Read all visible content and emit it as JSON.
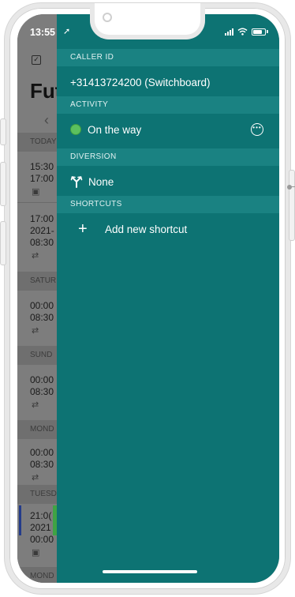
{
  "status_bar": {
    "time": "13:55"
  },
  "background_app": {
    "title": "Fut",
    "sections": [
      {
        "label": "TODAY",
        "rows": [
          [
            "15:30",
            "17:00"
          ]
        ]
      },
      {
        "label": "",
        "rows": [
          [
            "17:00",
            "2021-",
            "08:30"
          ]
        ]
      },
      {
        "label": "SATUR",
        "rows": [
          [
            "00:00",
            "08:30"
          ]
        ]
      },
      {
        "label": "SUND",
        "rows": [
          [
            "00:00",
            "08:30"
          ]
        ]
      },
      {
        "label": "MOND",
        "rows": [
          [
            "00:00",
            "08:30"
          ]
        ]
      },
      {
        "label": "TUESD",
        "rows": [
          [
            "21:0(",
            "2021",
            "00:00"
          ]
        ]
      },
      {
        "label": "MOND",
        "rows": []
      }
    ]
  },
  "drawer": {
    "caller_id": {
      "header": "CALLER ID",
      "value": "+31413724200 (Switchboard)"
    },
    "activity": {
      "header": "ACTIVITY",
      "value": "On the way",
      "status_color": "#5cc05e"
    },
    "diversion": {
      "header": "DIVERSION",
      "value": "None"
    },
    "shortcuts": {
      "header": "SHORTCUTS",
      "add_label": "Add new shortcut"
    }
  },
  "colors": {
    "drawer_bg": "#0d7373",
    "section_header_bg": "#1a8282",
    "dim_bg": "#777777"
  }
}
